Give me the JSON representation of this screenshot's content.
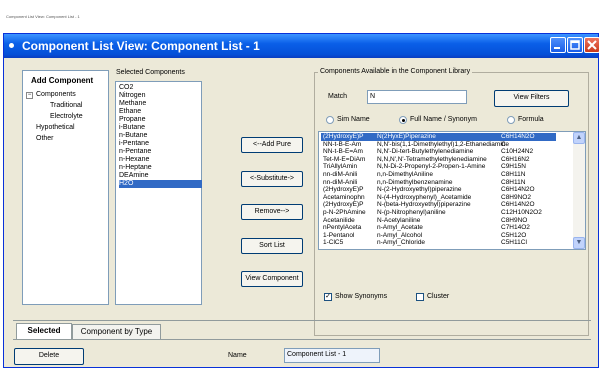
{
  "caption": "Component List View: Component List - 1",
  "window": {
    "title": "Component List View: Component List - 1"
  },
  "tree": {
    "title": "Add Component",
    "items": [
      "Components",
      "Traditional",
      "Electrolyte",
      "Hypothetical",
      "Other"
    ],
    "expander": "−"
  },
  "selected": {
    "title": "Selected Components",
    "items": [
      "CO2",
      "Nitrogen",
      "Methane",
      "Ethane",
      "Propane",
      "i-Butane",
      "n-Butane",
      "i-Pentane",
      "n-Pentane",
      "n-Hexane",
      "n-Heptane",
      "DEAmine",
      "H2O"
    ],
    "active_index": 12
  },
  "actions": {
    "add_pure": "<--Add Pure",
    "substitute": "<-Substitute->",
    "remove": "Remove-->",
    "sort_list": "Sort List",
    "view_component": "View Component"
  },
  "library": {
    "title": "Components Available in the Component Library",
    "match_label": "Match",
    "match_value": "N",
    "view_filters": "View Filters",
    "radio_sim": "Sim Name",
    "radio_full": "Full Name / Synonym",
    "radio_formula": "Formula",
    "selected_radio": "full",
    "rows": [
      [
        "(2HydroxyE)P",
        "N(2HyxE)Piperazine",
        "C6H14N2O"
      ],
      [
        "NN-t-B-E-Am",
        "N,N'-bis(1,1-Dimethylethyl)1,2-Ethanediamine",
        "C"
      ],
      [
        "NN-t-B-E=Am",
        "N,N'-Di-tert-Butylethylenediamine",
        "C10H24N2"
      ],
      [
        "Tet-M-E=DiAm",
        "N,N,N',N'-Tetramethylethylenediamine",
        "C6H16N2"
      ],
      [
        "TriAllylAmin",
        "N,N-Di-2-Propenyl-2-Propen-1-Amine",
        "C9H15N"
      ],
      [
        "nn-diM-Anili",
        "n,n-DimethylAniline",
        "C8H11N"
      ],
      [
        "nn-diM-Anili",
        "n,n-Dimethylbenzenamine",
        "C8H11N"
      ],
      [
        "(2HydroxyE)P",
        "N-(2-Hydroxyethyl)piperazine",
        "C6H14N2O"
      ],
      [
        "Acetaminophn",
        "N-(4-Hydroxyphenyl)_Acetamide",
        "C8H9NO2"
      ],
      [
        "(2HydroxyE)P",
        "N-(beta-Hydroxyethyl)piperazine",
        "C6H14N2O"
      ],
      [
        "p-N-2PhAmine",
        "N-(p-Nitrophenyl)aniline",
        "C12H10N2O2"
      ],
      [
        "Acetanilide",
        "N-Acetylaniline",
        "C8H9NO"
      ],
      [
        "nPentylAceta",
        "n-Amyl_Acetate",
        "C7H14O2"
      ],
      [
        "1-Pentanol",
        "n-Amyl_Alcohol",
        "C5H12O"
      ],
      [
        "1-ClC5",
        "n-Amyl_Chloride",
        "C5H11Cl"
      ]
    ],
    "active_index": 0,
    "show_synonyms": "Show Synonyms",
    "show_synonyms_checked": true,
    "cluster": "Cluster",
    "cluster_checked": false,
    "scroll_up": "▲",
    "scroll_down": "▼"
  },
  "tabs": [
    "Selected",
    "Component by Type"
  ],
  "active_tab": 0,
  "footer": {
    "delete": "Delete",
    "name_label": "Name",
    "name_value": "Component List - 1"
  },
  "colors": {
    "title_bar": "#0a5fe8",
    "selection": "#316ac5",
    "window_bg": "#ece9d8"
  }
}
